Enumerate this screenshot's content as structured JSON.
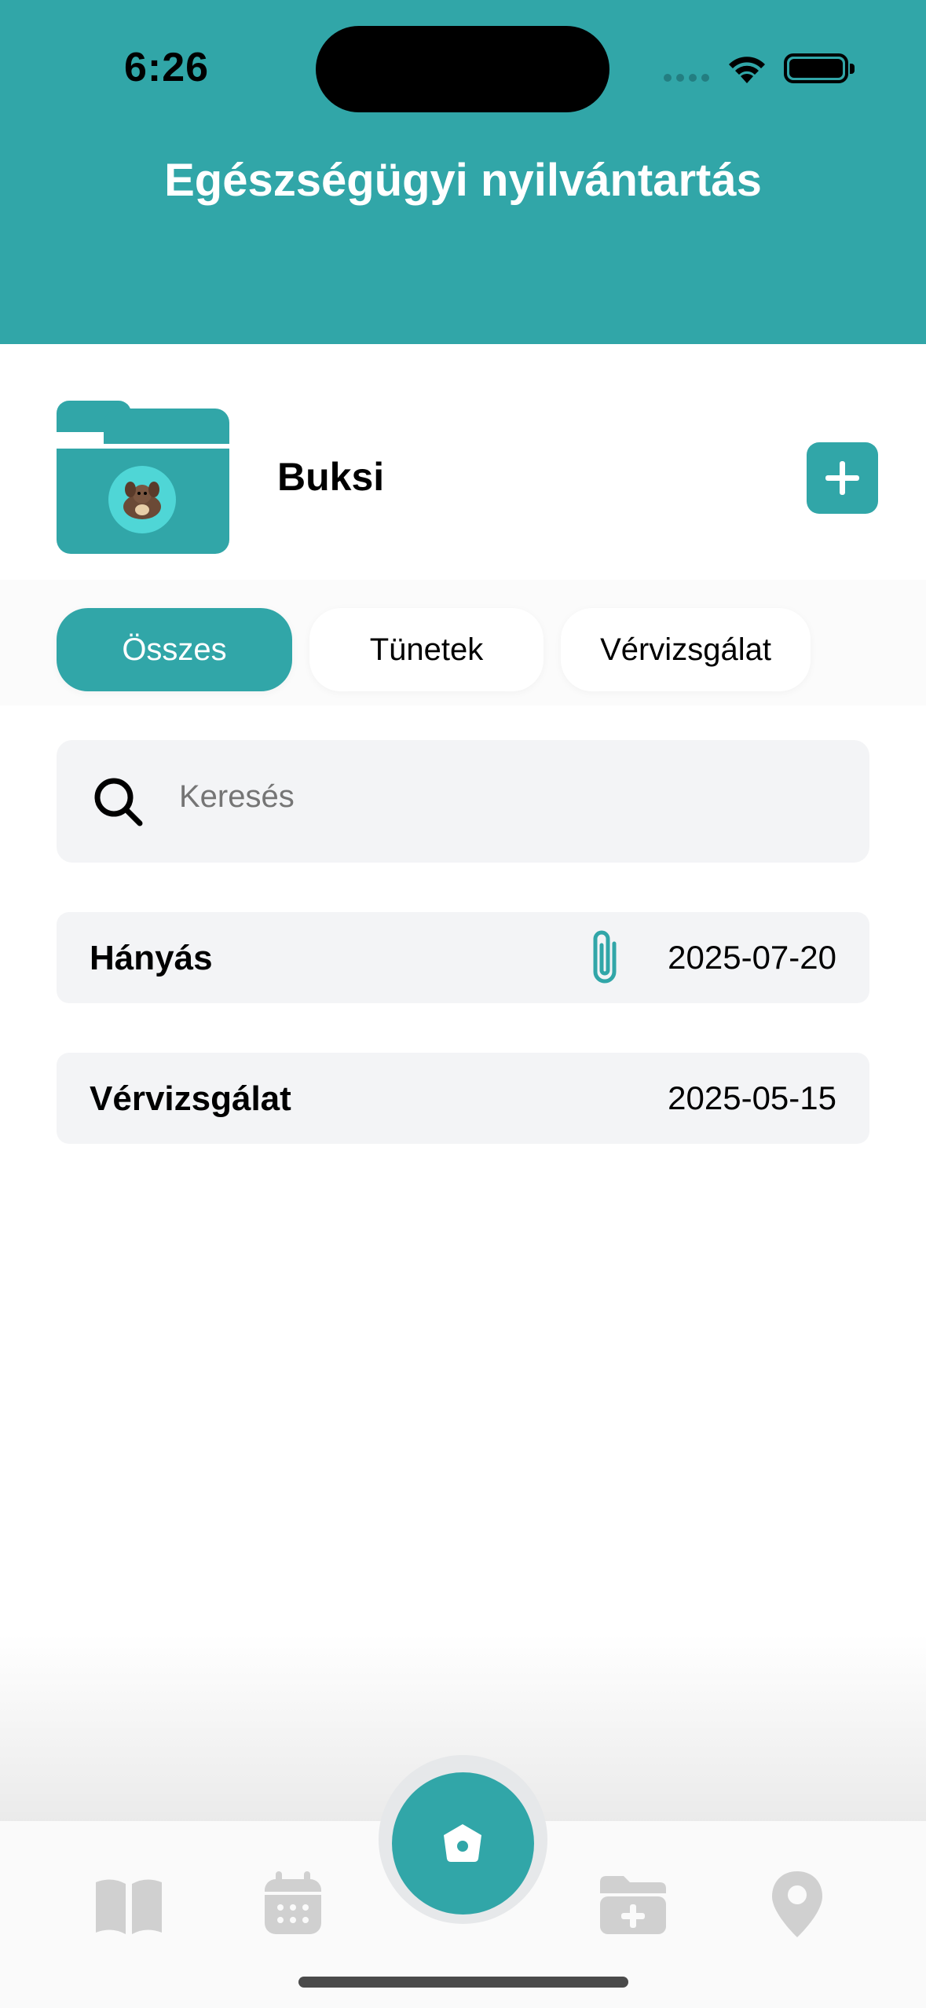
{
  "status_bar": {
    "time": "6:26"
  },
  "header": {
    "title": "Egészségügyi nyilvántartás",
    "background": "#31a6a8"
  },
  "pet": {
    "name": "Buksi",
    "add_icon": "plus-icon",
    "folder_icon": "folder-icon"
  },
  "filters": [
    {
      "label": "Összes",
      "active": true
    },
    {
      "label": "Tünetek",
      "active": false
    },
    {
      "label": "Vérvizsgálat",
      "active": false
    }
  ],
  "search": {
    "placeholder": "Keresés",
    "icon": "search-icon"
  },
  "records": [
    {
      "title": "Hányás",
      "date": "2025-07-20",
      "has_attachment": true
    },
    {
      "title": "Vérvizsgálat",
      "date": "2025-05-15",
      "has_attachment": false
    }
  ],
  "bottom_nav": {
    "items": [
      {
        "icon": "book-icon"
      },
      {
        "icon": "calendar-icon"
      },
      {
        "icon": "home-icon"
      },
      {
        "icon": "folder-add-icon"
      },
      {
        "icon": "location-pin-icon"
      }
    ]
  },
  "colors": {
    "accent": "#31a6a8",
    "surface": "#f3f4f6",
    "inactive_icon": "#d0d0d0"
  }
}
